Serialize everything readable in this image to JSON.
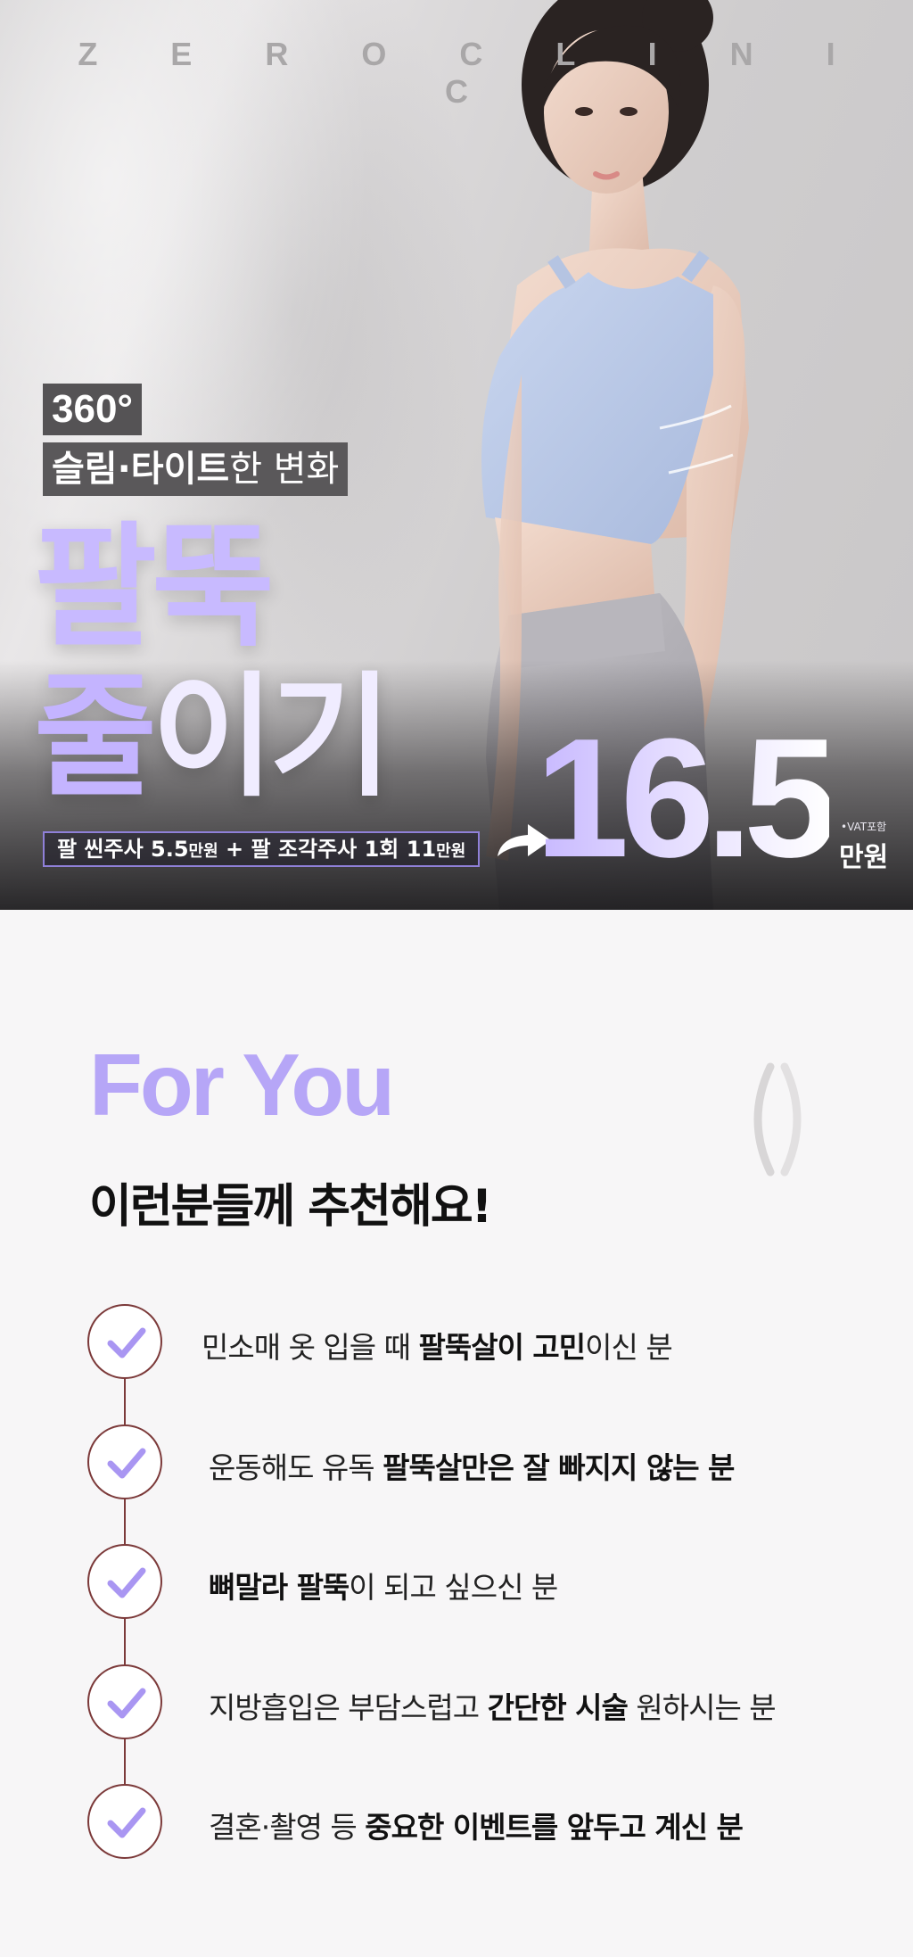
{
  "brand": "Z E R O   C L I N I C",
  "hero": {
    "badge_360": "360°",
    "subtitle_bold": "슬림·타이트",
    "subtitle_light": "한 변화",
    "headline_line1": "팔뚝",
    "headline_line2_a": "줄",
    "headline_line2_b": "이기",
    "price_breakdown": {
      "part1": "팔 씬주사 5.5",
      "part1_unit": "만원",
      "plus": " + ",
      "part2": "팔 조각주사 1회 11",
      "part2_unit": "만원"
    },
    "price_value": "16.5",
    "vat_note": "•VAT포함",
    "price_unit": "만원"
  },
  "for_you": {
    "heading": "For You",
    "title": "이런분들께 추천해요!",
    "items": [
      {
        "pre": "민소매 옷 입을 때 ",
        "bold": "팔뚝살이 고민",
        "post": "이신 분"
      },
      {
        "pre": "운동해도 유독 ",
        "bold": "팔뚝살만은 잘 빠지지 않는 분",
        "post": ""
      },
      {
        "pre": "",
        "bold": "뼈말라 팔뚝",
        "post": "이 되고 싶으신 분"
      },
      {
        "pre": "지방흡입은 부담스럽고 ",
        "bold": "간단한 시술",
        "post": " 원하시는 분"
      },
      {
        "pre": "결혼·촬영 등 ",
        "bold": "중요한 이벤트를 앞두고 계신 분",
        "post": ""
      }
    ]
  },
  "colors": {
    "accent_purple": "#b6a6f7",
    "check_purple": "#a996f2",
    "timeline_brown": "#7c3a3a"
  }
}
